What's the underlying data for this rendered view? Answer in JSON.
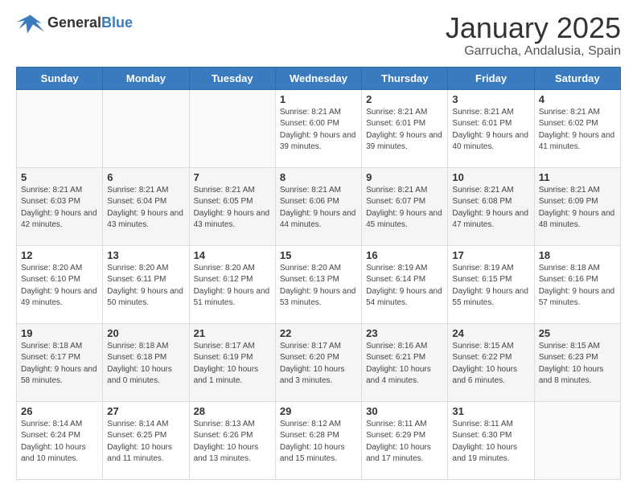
{
  "header": {
    "logo_general": "General",
    "logo_blue": "Blue",
    "title": "January 2025",
    "location": "Garrucha, Andalusia, Spain"
  },
  "weekdays": [
    "Sunday",
    "Monday",
    "Tuesday",
    "Wednesday",
    "Thursday",
    "Friday",
    "Saturday"
  ],
  "weeks": [
    [
      {
        "day": "",
        "info": ""
      },
      {
        "day": "",
        "info": ""
      },
      {
        "day": "",
        "info": ""
      },
      {
        "day": "1",
        "info": "Sunrise: 8:21 AM\nSunset: 6:00 PM\nDaylight: 9 hours and 39 minutes."
      },
      {
        "day": "2",
        "info": "Sunrise: 8:21 AM\nSunset: 6:01 PM\nDaylight: 9 hours and 39 minutes."
      },
      {
        "day": "3",
        "info": "Sunrise: 8:21 AM\nSunset: 6:01 PM\nDaylight: 9 hours and 40 minutes."
      },
      {
        "day": "4",
        "info": "Sunrise: 8:21 AM\nSunset: 6:02 PM\nDaylight: 9 hours and 41 minutes."
      }
    ],
    [
      {
        "day": "5",
        "info": "Sunrise: 8:21 AM\nSunset: 6:03 PM\nDaylight: 9 hours and 42 minutes."
      },
      {
        "day": "6",
        "info": "Sunrise: 8:21 AM\nSunset: 6:04 PM\nDaylight: 9 hours and 43 minutes."
      },
      {
        "day": "7",
        "info": "Sunrise: 8:21 AM\nSunset: 6:05 PM\nDaylight: 9 hours and 43 minutes."
      },
      {
        "day": "8",
        "info": "Sunrise: 8:21 AM\nSunset: 6:06 PM\nDaylight: 9 hours and 44 minutes."
      },
      {
        "day": "9",
        "info": "Sunrise: 8:21 AM\nSunset: 6:07 PM\nDaylight: 9 hours and 45 minutes."
      },
      {
        "day": "10",
        "info": "Sunrise: 8:21 AM\nSunset: 6:08 PM\nDaylight: 9 hours and 47 minutes."
      },
      {
        "day": "11",
        "info": "Sunrise: 8:21 AM\nSunset: 6:09 PM\nDaylight: 9 hours and 48 minutes."
      }
    ],
    [
      {
        "day": "12",
        "info": "Sunrise: 8:20 AM\nSunset: 6:10 PM\nDaylight: 9 hours and 49 minutes."
      },
      {
        "day": "13",
        "info": "Sunrise: 8:20 AM\nSunset: 6:11 PM\nDaylight: 9 hours and 50 minutes."
      },
      {
        "day": "14",
        "info": "Sunrise: 8:20 AM\nSunset: 6:12 PM\nDaylight: 9 hours and 51 minutes."
      },
      {
        "day": "15",
        "info": "Sunrise: 8:20 AM\nSunset: 6:13 PM\nDaylight: 9 hours and 53 minutes."
      },
      {
        "day": "16",
        "info": "Sunrise: 8:19 AM\nSunset: 6:14 PM\nDaylight: 9 hours and 54 minutes."
      },
      {
        "day": "17",
        "info": "Sunrise: 8:19 AM\nSunset: 6:15 PM\nDaylight: 9 hours and 55 minutes."
      },
      {
        "day": "18",
        "info": "Sunrise: 8:18 AM\nSunset: 6:16 PM\nDaylight: 9 hours and 57 minutes."
      }
    ],
    [
      {
        "day": "19",
        "info": "Sunrise: 8:18 AM\nSunset: 6:17 PM\nDaylight: 9 hours and 58 minutes."
      },
      {
        "day": "20",
        "info": "Sunrise: 8:18 AM\nSunset: 6:18 PM\nDaylight: 10 hours and 0 minutes."
      },
      {
        "day": "21",
        "info": "Sunrise: 8:17 AM\nSunset: 6:19 PM\nDaylight: 10 hours and 1 minute."
      },
      {
        "day": "22",
        "info": "Sunrise: 8:17 AM\nSunset: 6:20 PM\nDaylight: 10 hours and 3 minutes."
      },
      {
        "day": "23",
        "info": "Sunrise: 8:16 AM\nSunset: 6:21 PM\nDaylight: 10 hours and 4 minutes."
      },
      {
        "day": "24",
        "info": "Sunrise: 8:15 AM\nSunset: 6:22 PM\nDaylight: 10 hours and 6 minutes."
      },
      {
        "day": "25",
        "info": "Sunrise: 8:15 AM\nSunset: 6:23 PM\nDaylight: 10 hours and 8 minutes."
      }
    ],
    [
      {
        "day": "26",
        "info": "Sunrise: 8:14 AM\nSunset: 6:24 PM\nDaylight: 10 hours and 10 minutes."
      },
      {
        "day": "27",
        "info": "Sunrise: 8:14 AM\nSunset: 6:25 PM\nDaylight: 10 hours and 11 minutes."
      },
      {
        "day": "28",
        "info": "Sunrise: 8:13 AM\nSunset: 6:26 PM\nDaylight: 10 hours and 13 minutes."
      },
      {
        "day": "29",
        "info": "Sunrise: 8:12 AM\nSunset: 6:28 PM\nDaylight: 10 hours and 15 minutes."
      },
      {
        "day": "30",
        "info": "Sunrise: 8:11 AM\nSunset: 6:29 PM\nDaylight: 10 hours and 17 minutes."
      },
      {
        "day": "31",
        "info": "Sunrise: 8:11 AM\nSunset: 6:30 PM\nDaylight: 10 hours and 19 minutes."
      },
      {
        "day": "",
        "info": ""
      }
    ]
  ]
}
